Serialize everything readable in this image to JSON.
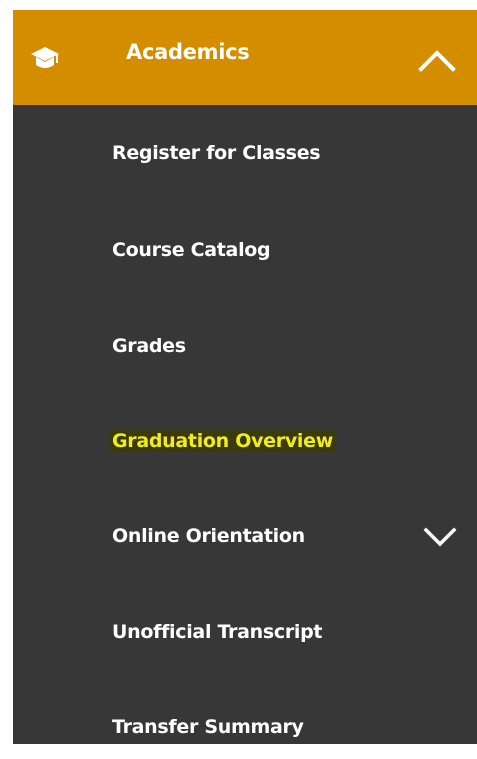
{
  "nav": {
    "section": {
      "label": "Academics",
      "icon": "graduation-cap-icon",
      "toggle_icon": "chevron-up-icon",
      "accent_color": "#d58d00"
    },
    "items": [
      {
        "label": "Register for Classes"
      },
      {
        "label": "Course Catalog"
      },
      {
        "label": "Grades"
      },
      {
        "label": "Graduation Overview",
        "highlighted": true
      },
      {
        "label": "Online Orientation",
        "toggle_icon": "chevron-down-icon"
      },
      {
        "label": "Unofficial Transcript"
      },
      {
        "label": "Transfer Summary"
      }
    ],
    "panel_color": "#373737",
    "highlight_color": "#f2ec1a"
  }
}
